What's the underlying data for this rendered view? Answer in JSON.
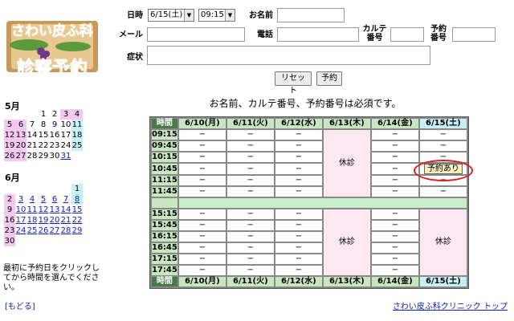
{
  "logo": {
    "line1": "さわい皮ふ科",
    "line2": "診察予約"
  },
  "calendars": [
    {
      "month": "5月",
      "rows": [
        [
          "",
          "",
          "",
          "1",
          "2",
          "3",
          "4"
        ],
        [
          "5",
          "6",
          "7",
          "8",
          "9",
          "10",
          "11"
        ],
        [
          "12",
          "13",
          "14",
          "15",
          "16",
          "17",
          "18"
        ],
        [
          "19",
          "20",
          "21",
          "22",
          "23",
          "24",
          "25"
        ],
        [
          "26",
          "27",
          "28",
          "29",
          "30",
          "31",
          ""
        ]
      ]
    },
    {
      "month": "6月",
      "rows": [
        [
          "",
          "",
          "",
          "",
          "",
          "",
          "1"
        ],
        [
          "2",
          "3",
          "4",
          "5",
          "6",
          "7",
          "8"
        ],
        [
          "9",
          "10",
          "11",
          "12",
          "13",
          "14",
          "15"
        ],
        [
          "16",
          "17",
          "18",
          "19",
          "20",
          "21",
          "22"
        ],
        [
          "23",
          "24",
          "25",
          "26",
          "27",
          "28",
          "29"
        ],
        [
          "30",
          "",
          "",
          "",
          "",
          "",
          ""
        ]
      ]
    }
  ],
  "sidebar": {
    "note": "最初に予約日をクリックしてから時間を選んでください。",
    "back_link": "[もどる]"
  },
  "form": {
    "datetime_label": "日時",
    "date_value": "6/15(土)",
    "time_value": "09:15",
    "name_label": "お名前",
    "email_label": "メール",
    "phone_label": "電話",
    "chart_label": "カルテ\n番号",
    "booking_label": "予約\n番号",
    "symptom_label": "症状",
    "reset_label": "リセット",
    "submit_label": "予約"
  },
  "required_note": "お名前、カルテ番号、予約番号は必須です。",
  "schedule": {
    "time_header": "時間",
    "days": [
      "6/10(月)",
      "6/11(火)",
      "6/12(水)",
      "6/13(木)",
      "6/14(金)",
      "6/15(土)"
    ],
    "morning_times": [
      "09:15",
      "09:45",
      "10:15",
      "10:45",
      "11:15",
      "11:45"
    ],
    "afternoon_times": [
      "15:15",
      "15:45",
      "16:15",
      "16:45",
      "17:15",
      "17:45"
    ],
    "empty_mark": "−",
    "closed_label": "休診",
    "booked_label": "予約あり"
  },
  "footer": {
    "clinic_link": "さわい皮ふ科クリニック トップ"
  }
}
